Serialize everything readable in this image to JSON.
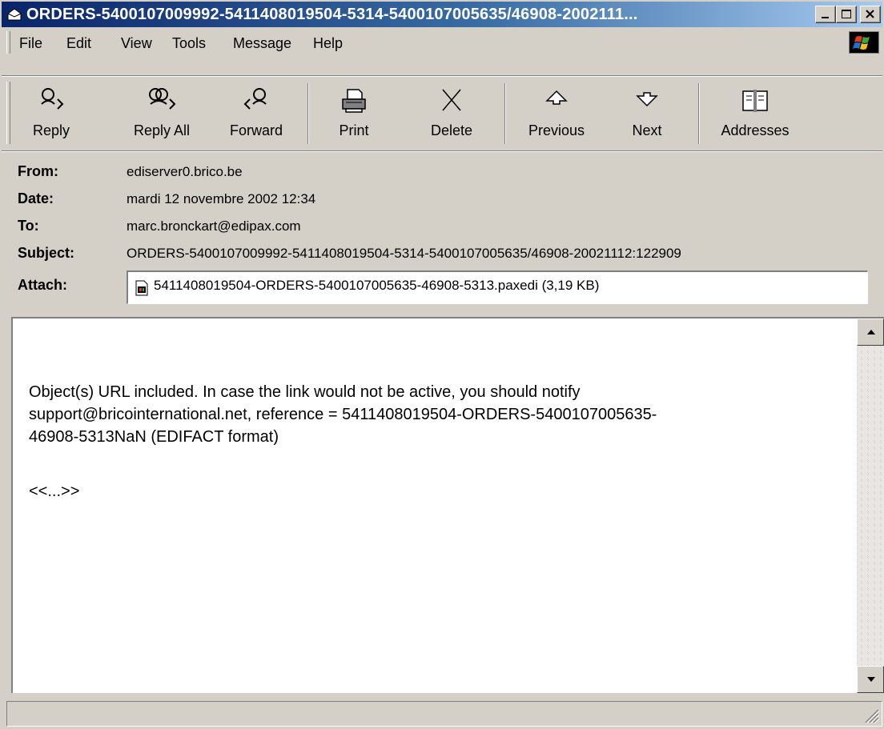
{
  "window": {
    "title": "ORDERS-5400107009992-5411408019504-5314-5400107005635/46908-2002111...",
    "controls": {
      "minimize": "minimize",
      "maximize": "maximize",
      "close": "close"
    }
  },
  "menu": {
    "items": [
      {
        "label": "File"
      },
      {
        "label": "Edit"
      },
      {
        "label": "View"
      },
      {
        "label": "Tools"
      },
      {
        "label": "Message"
      },
      {
        "label": "Help"
      }
    ]
  },
  "toolbar": {
    "buttons": [
      {
        "label": "Reply",
        "icon": "reply-icon"
      },
      {
        "label": "Reply All",
        "icon": "reply-all-icon"
      },
      {
        "label": "Forward",
        "icon": "forward-icon"
      },
      {
        "label": "Print",
        "icon": "printer-icon"
      },
      {
        "label": "Delete",
        "icon": "delete-x-icon"
      },
      {
        "label": "Previous",
        "icon": "up-arrow-icon"
      },
      {
        "label": "Next",
        "icon": "down-arrow-icon"
      },
      {
        "label": "Addresses",
        "icon": "address-book-icon"
      }
    ]
  },
  "header": {
    "from_label": "From:",
    "from": "ediserver0.brico.be",
    "date_label": "Date:",
    "date": "mardi 12 novembre 2002 12:34",
    "to_label": "To:",
    "to": "marc.bronckart@edipax.com",
    "subject_label": "Subject:",
    "subject": "ORDERS-5400107009992-5411408019504-5314-5400107005635/46908-20021112:122909",
    "attach_label": "Attach:",
    "attachment": "5411408019504-ORDERS-5400107005635-46908-5313.paxedi (3,19 KB)"
  },
  "body": {
    "line1": "Object(s) URL included. In case the link would not be active, you should notify",
    "line2": "support@bricointernational.net, reference = 5411408019504-ORDERS-5400107005635-",
    "line3": "46908-5313NaN    (EDIFACT format)",
    "line4": "<<...>>"
  },
  "status": {
    "text": ""
  },
  "colors": {
    "title_start": "#0a246a",
    "title_end": "#a6caf0",
    "face": "#d4d0c8"
  }
}
